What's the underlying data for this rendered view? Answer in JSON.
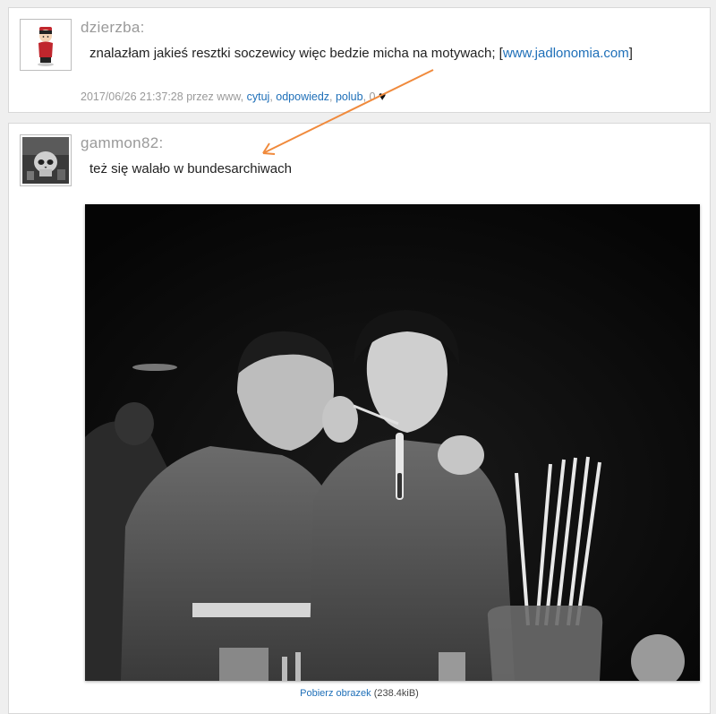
{
  "comments": [
    {
      "author": "dzierzba:",
      "text_before": "znalazłam jakieś resztki soczewicy więc bedzie micha na motywach; [",
      "link_text": "www.jadlonomia.com",
      "text_after": "]",
      "meta": {
        "timestamp": "2017/06/26 21:37:28",
        "by_label": "przez",
        "source": "www",
        "cite": "cytuj",
        "reply": "odpowiedz",
        "like": "polub",
        "like_count": "0",
        "heart": "♥"
      }
    },
    {
      "author": "gammon82:",
      "text": "też się walało w bundesarchiwach",
      "image": {
        "download_label": "Pobierz obrazek",
        "size": "(238.4kiB)"
      }
    }
  ],
  "colors": {
    "link": "#1e6fb8",
    "author": "#9a9a9a",
    "arrow": "#f08a3c"
  }
}
